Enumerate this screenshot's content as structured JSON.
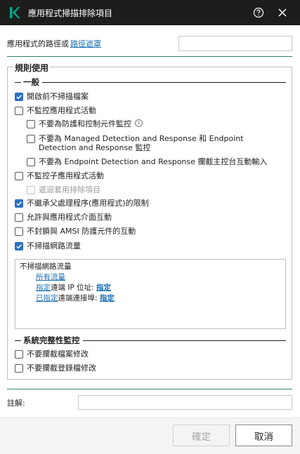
{
  "window": {
    "title": "應用程式掃描排除項目"
  },
  "path": {
    "label": "應用程式的路徑或",
    "link": "路徑遮罩",
    "value": ""
  },
  "group": {
    "title": "規則使用",
    "general": {
      "heading": "一般",
      "options": [
        {
          "label": "開啟前不掃描檔案",
          "checked": true
        },
        {
          "label": "不監控應用程式活動",
          "checked": false
        },
        {
          "label": "不要為防護和控制元件監控",
          "checked": false,
          "info": true
        },
        {
          "label": "不要為 Managed Detection and Response 和 Endpoint Detection and Response 監控",
          "checked": false
        },
        {
          "label": "不要為 Endpoint Detection and Response 攔截主控台互動輸入",
          "checked": false
        },
        {
          "label": "不監控子應用程式活動",
          "checked": false
        },
        {
          "label": "遞迴套用排除項目",
          "checked": false,
          "disabled": true
        },
        {
          "label": "不繼承父處理程序(應用程式)的限制",
          "checked": true
        },
        {
          "label": "允許與應用程式介面互動",
          "checked": false
        },
        {
          "label": "不封鎖與 AMSI 防護元件的互動",
          "checked": false
        },
        {
          "label": "不掃描網路流量",
          "checked": true
        }
      ]
    },
    "rule_box": {
      "title": "不掃描網路流量",
      "line1_link": "所有流量",
      "line2_link": "指定",
      "line2_text": "遠端 IP 位址:",
      "line2_value": "指定",
      "line3_link": "已指定",
      "line3_text": "遠端連接埠:",
      "line3_value": "指定"
    },
    "integrity": {
      "heading": "系統完整性監控",
      "options": [
        {
          "label": "不要攔截檔案修改",
          "checked": false
        },
        {
          "label": "不要攔截登錄檔修改",
          "checked": false
        }
      ]
    }
  },
  "comment": {
    "label": "註解:",
    "value": ""
  },
  "footer": {
    "ok_label": "確定",
    "cancel_label": "取消"
  },
  "colors": {
    "accent": "#2b6fc2",
    "divider": "#2f7d6a",
    "titlebar": "#1d1d1b",
    "link": "#1a6fb5"
  }
}
